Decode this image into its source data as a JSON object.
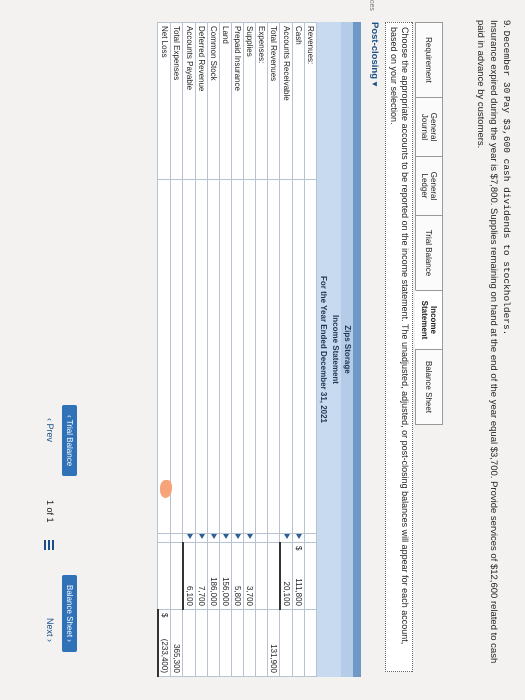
{
  "left_tab": "ces",
  "problem": {
    "number": "9.",
    "date": "December 30",
    "text_mono": "Pay $3,600 cash dividends to stockholders.",
    "text": "Insurance expired during the year is $7,800. Supplies remaining on hand at the end of the year equal $3,700. Provide services of $12,600 related to cash paid in advance by customers."
  },
  "tabs": [
    {
      "label": "Requirement",
      "active": false
    },
    {
      "label": "General Journal",
      "active": false
    },
    {
      "label": "General Ledger",
      "active": false
    },
    {
      "label": "Trial Balance",
      "active": false
    },
    {
      "label": "Income Statement",
      "active": true
    },
    {
      "label": "Balance Sheet",
      "active": false
    }
  ],
  "instruction": "Choose the appropriate accounts to be reported on the income statement. The unadjusted, adjusted, or post-closing balances will appear for each account, based on your selection.",
  "section_button": "Post-closing",
  "statement": {
    "company": "Zips Storage",
    "title": "Income Statement",
    "period": "For the Year Ended December 31, 2021",
    "rows": [
      {
        "label": "Revenues:",
        "indent": 0,
        "arrow": false,
        "col1": "",
        "col1_cur": "",
        "col2": "",
        "col2_cur": ""
      },
      {
        "label": "Cash",
        "indent": 1,
        "arrow": true,
        "col1": "111,800",
        "col1_cur": "$",
        "col2": "",
        "col2_cur": ""
      },
      {
        "label": "Accounts Receivable",
        "indent": 1,
        "arrow": true,
        "col1": "20,100",
        "col1_cur": "",
        "col2": "",
        "col2_cur": ""
      },
      {
        "label": "Total Revenues",
        "indent": 2,
        "arrow": false,
        "col1": "",
        "col1_cur": "",
        "col2": "131,900",
        "col2_cur": ""
      },
      {
        "label": "Expenses:",
        "indent": 0,
        "arrow": false,
        "col1": "",
        "col1_cur": "",
        "col2": "",
        "col2_cur": ""
      },
      {
        "label": "Supplies",
        "indent": 1,
        "arrow": true,
        "col1": "3,700",
        "col1_cur": "",
        "col2": "",
        "col2_cur": ""
      },
      {
        "label": "Prepaid Insurance",
        "indent": 1,
        "arrow": true,
        "col1": "5,800",
        "col1_cur": "",
        "col2": "",
        "col2_cur": ""
      },
      {
        "label": "Land",
        "indent": 1,
        "arrow": true,
        "col1": "156,000",
        "col1_cur": "",
        "col2": "",
        "col2_cur": ""
      },
      {
        "label": "Common Stock",
        "indent": 1,
        "arrow": true,
        "col1": "186,000",
        "col1_cur": "",
        "col2": "",
        "col2_cur": ""
      },
      {
        "label": "Deferred Revenue",
        "indent": 1,
        "arrow": true,
        "col1": "7,700",
        "col1_cur": "",
        "col2": "",
        "col2_cur": ""
      },
      {
        "label": "Accounts Payable",
        "indent": 1,
        "arrow": true,
        "col1": "6,100",
        "col1_cur": "",
        "col2": "",
        "col2_cur": ""
      },
      {
        "label": "Total Expenses",
        "indent": 2,
        "arrow": false,
        "col1": "",
        "col1_cur": "",
        "col2": "365,300",
        "col2_cur": ""
      },
      {
        "label": "Net Loss",
        "indent": 0,
        "arrow": false,
        "col1": "",
        "col1_cur": "",
        "col2": "(233,400)",
        "col2_cur": "$"
      }
    ]
  },
  "nav": {
    "prev_tab": "Trial Balance",
    "next_tab": "Balance Sheet",
    "prev": "Prev",
    "page": "1 of 1",
    "next": "Next"
  }
}
